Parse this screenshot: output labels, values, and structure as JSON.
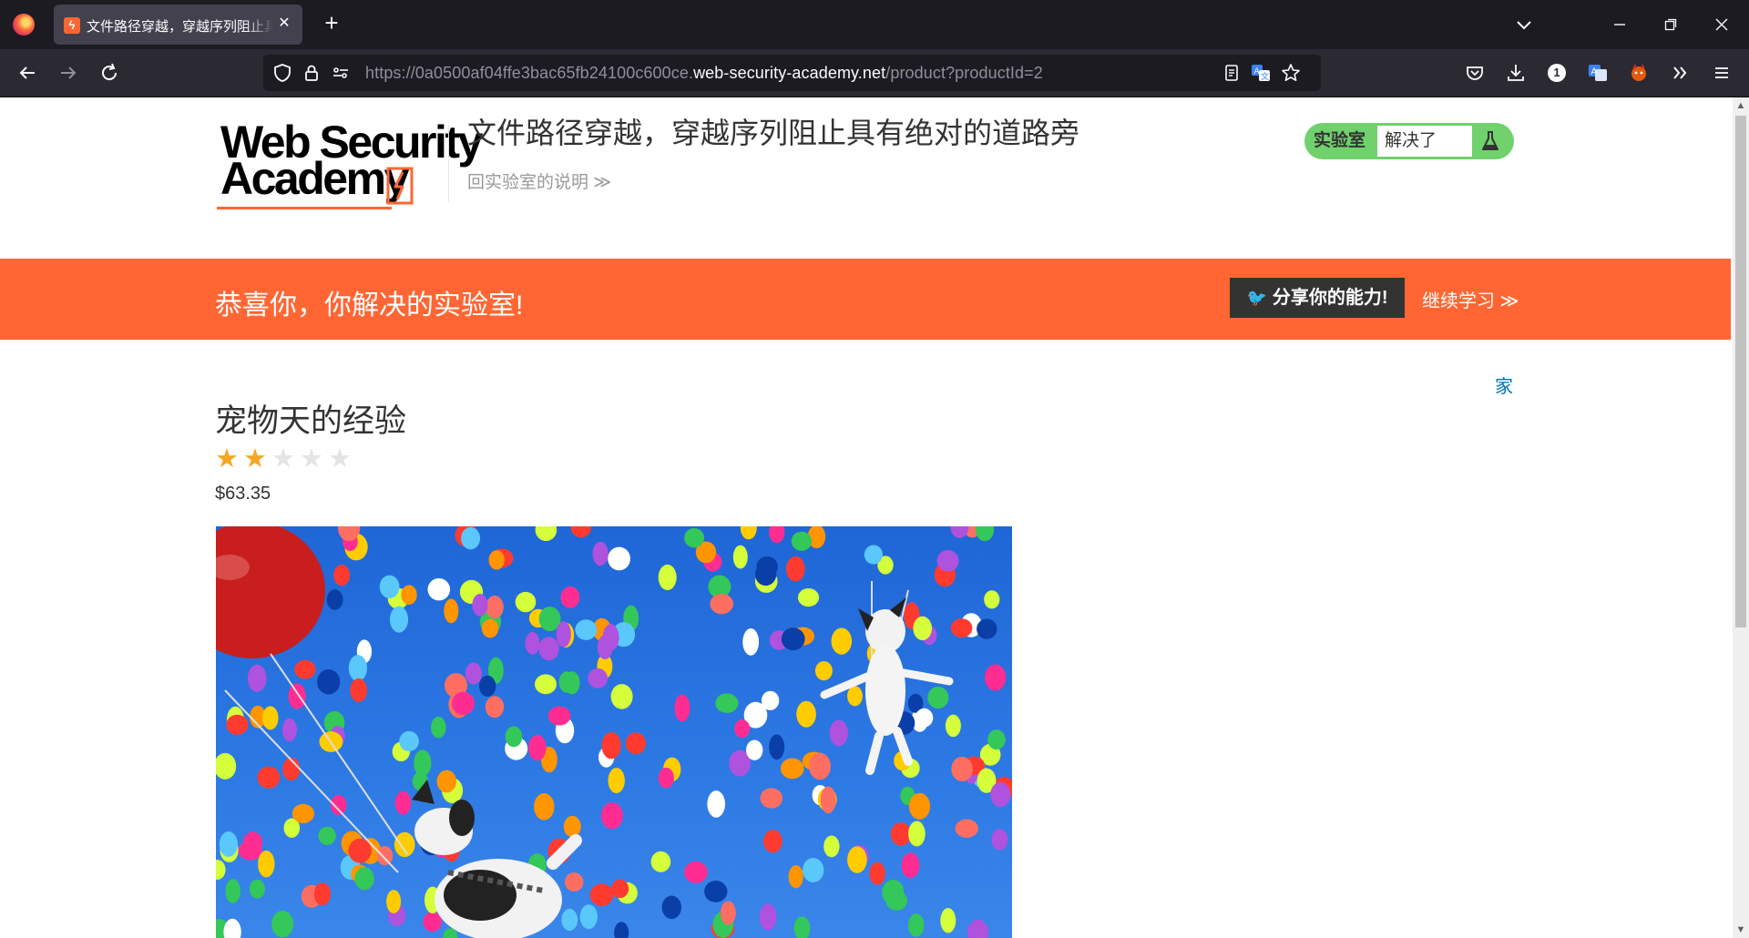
{
  "browser": {
    "tab_title": "文件路径穿越，穿越序列阻止具有绝对的道路旁",
    "url_prefix": "https://0a0500af04ffe3bac65fb24100c600ce.",
    "url_host": "web-security-academy.net",
    "url_path": "/product?productId=2",
    "notification_count": "1",
    "icons": [
      "firefox-logo",
      "tab-favicon",
      "close-icon",
      "plus-icon",
      "chevron-down-icon",
      "minimize-icon",
      "restore-icon",
      "close-window-icon",
      "back-icon",
      "forward-icon",
      "reload-icon",
      "shield-icon",
      "lock-icon",
      "permissions-icon",
      "reader-view-icon",
      "translate-icon",
      "star-icon",
      "pocket-icon",
      "download-icon",
      "extension-badge-icon",
      "translate-extension-icon",
      "fox-extension-icon",
      "overflow-icon",
      "menu-icon"
    ]
  },
  "header": {
    "logo_line1": "Web Security",
    "logo_line2": "Academy",
    "lab_title": "文件路径穿越，穿越序列阻止具有绝对的道路旁",
    "back_link": "回实验室的说明 ≫",
    "status_label": "实验室",
    "status_value": "解决了"
  },
  "banner": {
    "message": "恭喜你，你解决的实验室!",
    "share_label": "分享你的能力!",
    "continue_label": "继续学习 ≫"
  },
  "nav": {
    "home_label": "家"
  },
  "product": {
    "title": "宠物天的经验",
    "rating": 2,
    "rating_max": 5,
    "price": "$63.35",
    "image": "dogs flying with colorful balloons in blue sky"
  },
  "colors": {
    "accent": "#ff6633",
    "solved_green": "#70d16d",
    "link_blue": "#0071bc",
    "star": "#f6a623"
  }
}
